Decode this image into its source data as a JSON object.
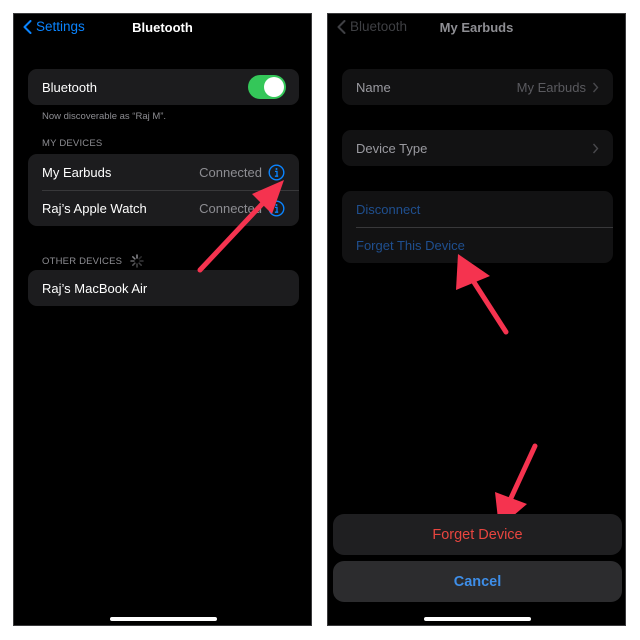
{
  "colors": {
    "accent_blue": "#0a84ff",
    "toggle_on": "#34c759",
    "destructive_red": "#ff453a",
    "annotation_arrow": "#f5334f"
  },
  "left_screen": {
    "nav": {
      "back_label": "Settings",
      "title": "Bluetooth"
    },
    "bluetooth_row": {
      "label": "Bluetooth",
      "toggle_on": true
    },
    "discoverable_note": "Now discoverable as “Raj M”.",
    "my_devices": {
      "header": "MY DEVICES",
      "items": [
        {
          "name": "My Earbuds",
          "status": "Connected",
          "icon": "info-icon"
        },
        {
          "name": "Raj’s Apple Watch",
          "status": "Connected",
          "icon": "info-icon"
        }
      ]
    },
    "other_devices": {
      "header": "OTHER DEVICES",
      "icon": "spinner-icon",
      "items": [
        {
          "name": "Raj’s MacBook Air"
        }
      ]
    }
  },
  "right_screen": {
    "nav": {
      "back_label": "Bluetooth",
      "title": "My Earbuds"
    },
    "name_row": {
      "label": "Name",
      "value": "My Earbuds"
    },
    "device_type_row": {
      "label": "Device Type"
    },
    "actions": [
      {
        "label": "Disconnect"
      },
      {
        "label": "Forget This Device"
      }
    ],
    "action_sheet": {
      "confirm_label": "Forget Device",
      "cancel_label": "Cancel"
    }
  }
}
